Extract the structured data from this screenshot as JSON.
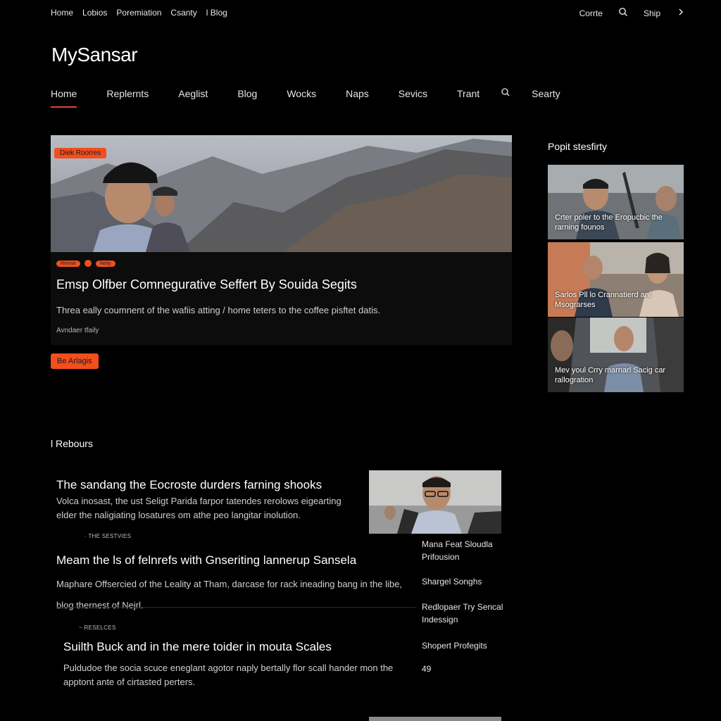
{
  "top_nav": [
    "Home",
    "Lobios",
    "Poremiation",
    "Csanty",
    "l Blog"
  ],
  "top_right": {
    "link": "Corrte",
    "shop_label": "Ship"
  },
  "site": {
    "logo": "MySansar"
  },
  "main_nav": {
    "items": [
      "Home",
      "Replernts",
      "Aeglist",
      "Blog",
      "Wocks",
      "Naps",
      "Sevics",
      "Trant"
    ],
    "search_label": "Searty",
    "active_index": 0
  },
  "hero": {
    "badge": "Diek Roorres",
    "tag_1": "Rinnse",
    "tag_2": "Neity",
    "title": "Emsp Olfber Comnegurative Seffert By Souida Segits",
    "description": "Threa eally coumnent of the wafiis atting / home teters to the coffee pisftet datis.",
    "author": "Avndaer tfaily",
    "button": "Be Arlagis"
  },
  "sidebar": {
    "title": "Popit stesfirty",
    "cards": [
      {
        "caption": "Crter poler to the Eropucbic the rarning founos"
      },
      {
        "caption": "Sarlos Pll lo Crannatierd anl Msograrses"
      },
      {
        "caption": "Mev youl Crry marnarl Sacig car rallogration"
      }
    ]
  },
  "section": {
    "title": "l Rebours",
    "articles": [
      {
        "title": "The sandang the Eocroste durders farning shooks",
        "desc_1": "Volca inosast, the ust Seligt Parida farpor tatendes rerolows eigearting",
        "desc_2": "elder the naligiating losatures om athe peo langitar inolution."
      },
      {
        "kicker": "· THE SESTVIES",
        "title": "Meam the ls of felnrefs with Gnseriting lannerup Sansela",
        "desc_1": "Maphare Offsercied of the Leality at Tham, darcase for rack ineading bang in the libe,",
        "desc_2": "blog thernest of Nejrl."
      },
      {
        "kicker": "~ RESELCES",
        "title": "Suilth Buck and in the mere toider in mouta Scales",
        "desc_1": "Puldudoe the socia scuce eneglant agotor naply bertally flor scall hander mon the",
        "desc_2": "apptont ante of cirtasted perters."
      }
    ],
    "side_list": [
      {
        "line_1": "Mana Feat Sloudla",
        "line_2": "Prifousion"
      },
      {
        "line_1": "Shargel Songhs"
      },
      {
        "line_1": "Redlopaer Try Sencal",
        "line_2": "Indessign"
      },
      {
        "line_1": "Shopert Profegits"
      },
      {
        "line_1": "49"
      }
    ]
  },
  "colors": {
    "accent": "#f24e1e",
    "background": "#000000",
    "text": "#ffffff"
  },
  "icons": {
    "search": "search-icon",
    "chevron": "chevron-right-icon"
  }
}
